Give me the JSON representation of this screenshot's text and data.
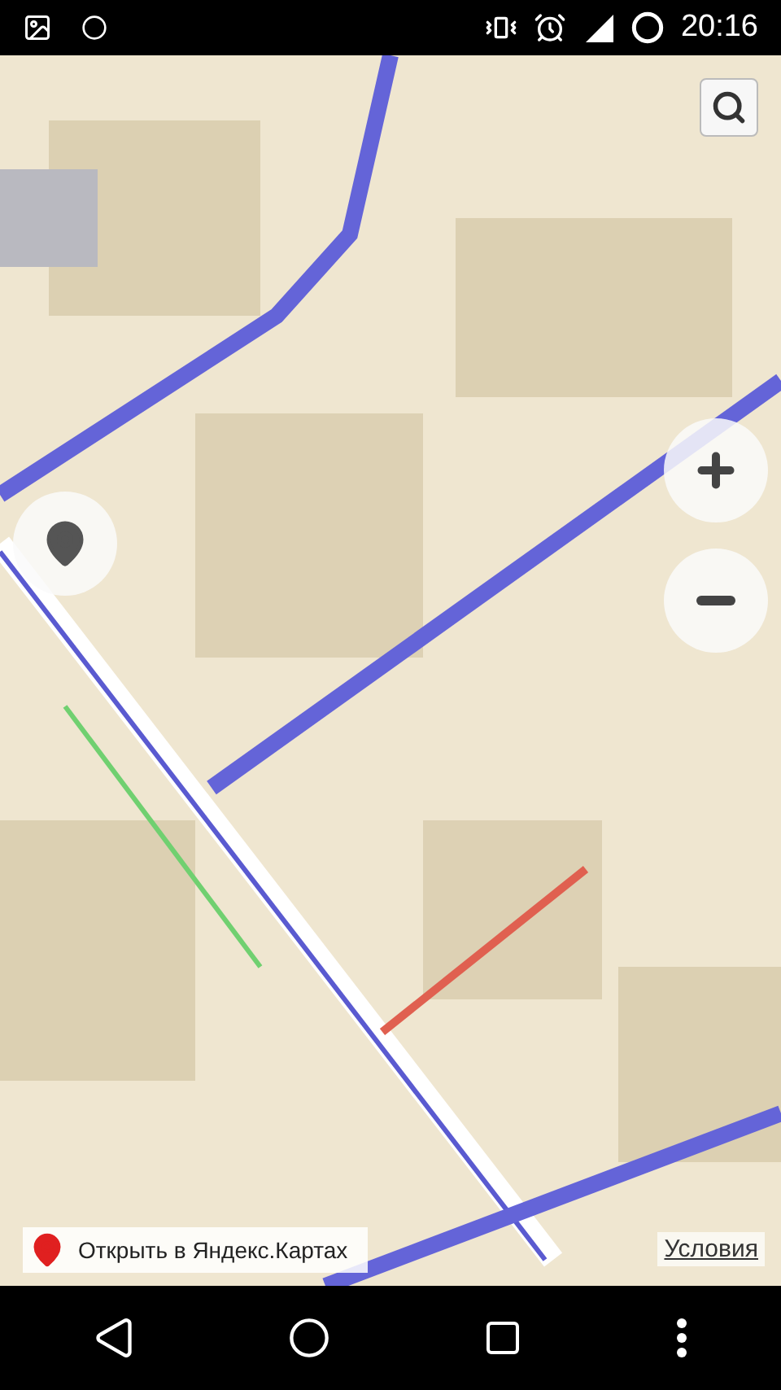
{
  "status_bar": {
    "time": "20:16"
  },
  "map": {
    "open_link": "Открыть в Яндекс.Картах",
    "terms_link": "Условия"
  }
}
